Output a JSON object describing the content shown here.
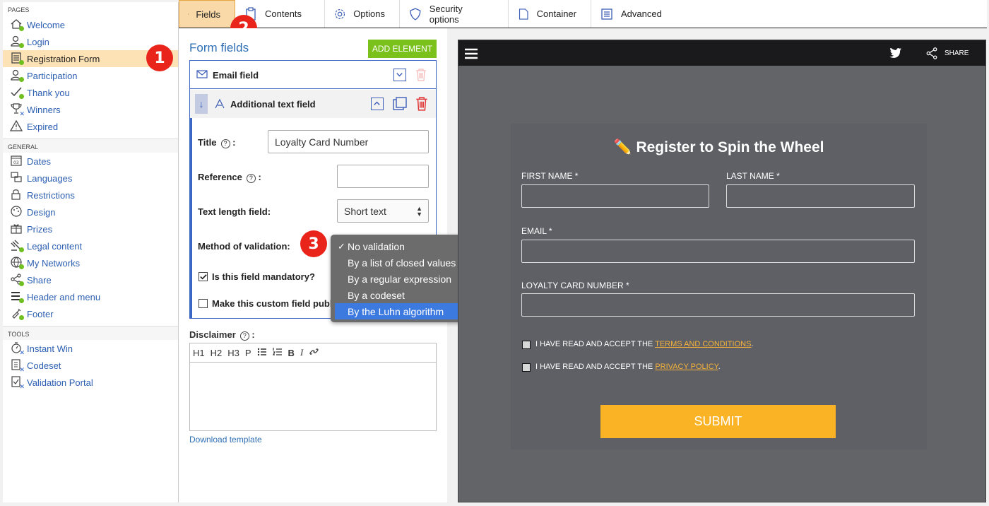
{
  "sidebar": {
    "pages_heading": "PAGES",
    "pages": [
      {
        "label": "Welcome",
        "icon": "home-icon",
        "status": "ok"
      },
      {
        "label": "Login",
        "icon": "user-login-icon",
        "status": "ok"
      },
      {
        "label": "Registration Form",
        "icon": "form-icon",
        "status": "ok",
        "active": true
      },
      {
        "label": "Participation",
        "icon": "user-icon",
        "status": "ok"
      },
      {
        "label": "Thank you",
        "icon": "user-check-icon",
        "status": "ok"
      },
      {
        "label": "Winners",
        "icon": "trophy-icon",
        "status": "off"
      },
      {
        "label": "Expired",
        "icon": "warning-icon",
        "status": "off"
      }
    ],
    "general_heading": "GENERAL",
    "general": [
      {
        "label": "Dates",
        "icon": "calendar-icon"
      },
      {
        "label": "Languages",
        "icon": "languages-icon"
      },
      {
        "label": "Restrictions",
        "icon": "lock-icon"
      },
      {
        "label": "Design",
        "icon": "palette-icon"
      },
      {
        "label": "Prizes",
        "icon": "gift-icon"
      },
      {
        "label": "Legal content",
        "icon": "gavel-icon"
      },
      {
        "label": "My Networks",
        "icon": "globe-icon"
      },
      {
        "label": "Share",
        "icon": "share-icon"
      },
      {
        "label": "Header and menu",
        "icon": "menu-icon"
      },
      {
        "label": "Footer",
        "icon": "footer-icon"
      }
    ],
    "tools_heading": "TOOLS",
    "tools": [
      {
        "label": "Instant Win",
        "icon": "stopwatch-icon",
        "status": "off"
      },
      {
        "label": "Codeset",
        "icon": "codeset-icon",
        "status": "off"
      },
      {
        "label": "Validation Portal",
        "icon": "validation-icon",
        "status": "off"
      }
    ]
  },
  "tabs": [
    {
      "label": "Fields",
      "icon": "fields-icon",
      "active": true
    },
    {
      "label": "Contents",
      "icon": "clipboard-icon"
    },
    {
      "label": "Options",
      "icon": "gear-icon"
    },
    {
      "label": "Security options",
      "icon": "shield-icon"
    },
    {
      "label": "Container",
      "icon": "page-icon"
    },
    {
      "label": "Advanced",
      "icon": "advanced-icon"
    }
  ],
  "badges": {
    "one": "1",
    "two": "2",
    "three": "3"
  },
  "editor": {
    "title": "Form fields",
    "add_element": "ADD ELEMENT",
    "email_field": "Email field",
    "additional_field": "Additional text field",
    "title_label": "Title",
    "title_value": "Loyalty Card Number",
    "reference_label": "Reference",
    "reference_value": "",
    "text_length_label": "Text length field:",
    "text_length_value": "Short text",
    "validation_label": "Method of validation:",
    "mandatory_label": "Is this field mandatory?",
    "mandatory_checked": true,
    "public_label": "Make this custom field publ",
    "public_checked": false,
    "disclaimer_label": "Disclaimer",
    "rte_tools": [
      "H1",
      "H2",
      "H3",
      "P",
      "bullet-list-icon",
      "numbered-list-icon",
      "B",
      "I",
      "link-icon"
    ],
    "download_template": "Download template"
  },
  "dropdown": {
    "options": [
      {
        "label": "No validation",
        "checked": true
      },
      {
        "label": "By a list of closed values"
      },
      {
        "label": "By a regular expression"
      },
      {
        "label": "By a codeset"
      },
      {
        "label": "By the Luhn algorithm",
        "highlighted": true
      }
    ]
  },
  "preview": {
    "share_label": "SHARE",
    "heading": "✏️ Register to Spin the Wheel",
    "first_name": "FIRST NAME *",
    "last_name": "LAST NAME *",
    "email": "EMAIL *",
    "loyalty": "LOYALTY CARD NUMBER *",
    "terms_prefix": "I HAVE READ AND ACCEPT THE ",
    "terms_link": "TERMS AND CONDITIONS",
    "terms_suffix": ".",
    "privacy_prefix": "I HAVE READ AND ACCEPT THE ",
    "privacy_link": "PRIVACY POLICY",
    "privacy_suffix": ".",
    "submit": "SUBMIT"
  },
  "colors": {
    "accent_blue": "#2f6fb6",
    "active_nav": "#fde2b5",
    "badge_red": "#e9251b",
    "add_green": "#7ac11c",
    "submit_orange": "#fbb326",
    "dropdown_highlight": "#3d7ae0"
  }
}
